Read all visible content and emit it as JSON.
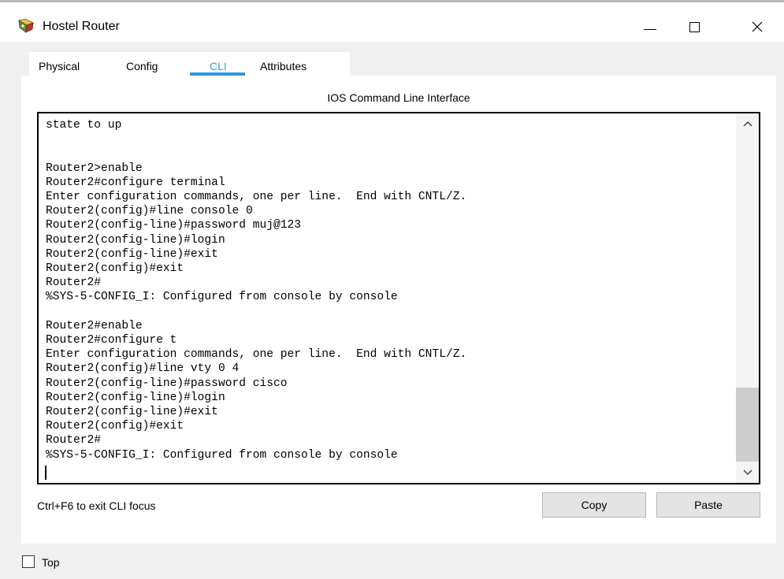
{
  "window": {
    "title": "Hostel Router",
    "icon": "router-icon",
    "controls": [
      "minimize-icon",
      "maximize-icon",
      "close-icon"
    ]
  },
  "tabs": [
    {
      "label": "Physical",
      "active": false
    },
    {
      "label": "Config",
      "active": false
    },
    {
      "label": "CLI",
      "active": true
    },
    {
      "label": "Attributes",
      "active": false
    }
  ],
  "cli": {
    "heading": "IOS Command Line Interface",
    "lines": [
      "state to up",
      "",
      "",
      "Router2>enable",
      "Router2#configure terminal",
      "Enter configuration commands, one per line.  End with CNTL/Z.",
      "Router2(config)#line console 0",
      "Router2(config-line)#password muj@123",
      "Router2(config-line)#login",
      "Router2(config-line)#exit",
      "Router2(config)#exit",
      "Router2#",
      "%SYS-5-CONFIG_I: Configured from console by console",
      "",
      "Router2#enable",
      "Router2#configure t",
      "Enter configuration commands, one per line.  End with CNTL/Z.",
      "Router2(config)#line vty 0 4",
      "Router2(config-line)#password cisco",
      "Router2(config-line)#login",
      "Router2(config-line)#exit",
      "Router2(config)#exit",
      "Router2#",
      "%SYS-5-CONFIG_I: Configured from console by console"
    ],
    "hint": "Ctrl+F6 to exit CLI focus",
    "copy_label": "Copy",
    "paste_label": "Paste"
  },
  "footer": {
    "top_label": "Top",
    "top_checked": false
  },
  "colors": {
    "active_tab": "#3aa0da",
    "tab_underline": "#2c97de"
  }
}
